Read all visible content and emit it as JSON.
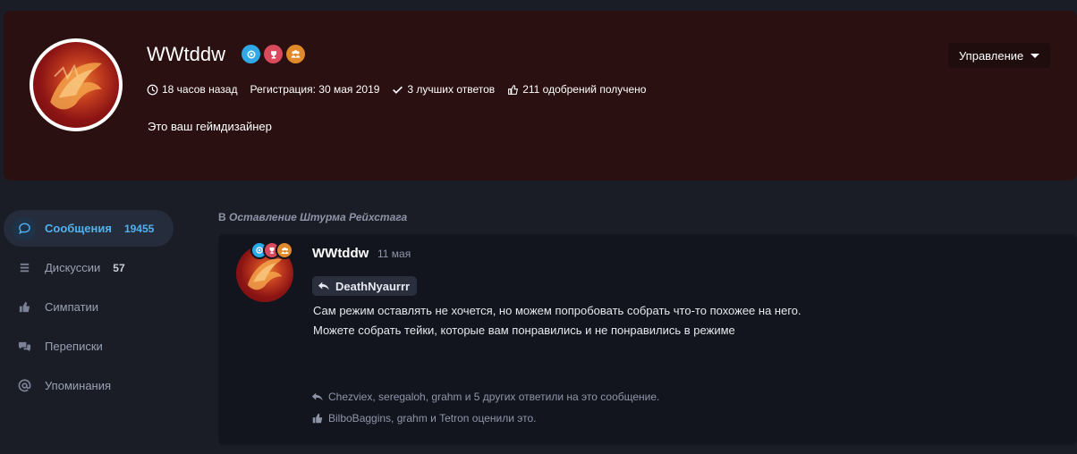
{
  "profile": {
    "username": "WWtddw",
    "last_seen": "18 часов назад",
    "registration": "Регистрация: 30 мая 2019",
    "best_answers": "3 лучших ответов",
    "reactions": "211 одобрений получено",
    "status_text": "Это ваш геймдизайнер",
    "manage_label": "Управление",
    "badges": [
      {
        "icon": "swirl-icon",
        "color": "#2fa8e6"
      },
      {
        "icon": "trophy-icon",
        "color": "#d84a5c"
      },
      {
        "icon": "group-icon",
        "color": "#e08a2a"
      }
    ]
  },
  "sidebar": {
    "items": [
      {
        "label": "Сообщения",
        "count": "19455",
        "icon": "message-icon",
        "active": true
      },
      {
        "label": "Дискуссии",
        "count": "57",
        "icon": "list-icon",
        "active": false
      },
      {
        "label": "Симпатии",
        "count": "",
        "icon": "thumbs-up-icon",
        "active": false
      },
      {
        "label": "Переписки",
        "count": "",
        "icon": "chat-icon",
        "active": false
      },
      {
        "label": "Упоминания",
        "count": "",
        "icon": "at-icon",
        "active": false
      }
    ]
  },
  "post": {
    "breadcrumb_prefix": "В",
    "breadcrumb_thread": "Оставление Штурма Рейхстага",
    "author": "WWtddw",
    "date": "11 мая",
    "quote_user": "DeathNyaurrr",
    "lines": [
      "Сам режим оставлять не хочется, но можем попробовать собрать что-то похожее на него.",
      "Можете собрать тейки, которые вам понравились и не понравились в режиме"
    ],
    "replies_text": "Chezviex, seregaloh, grahm и 5 других ответили на это сообщение.",
    "likes_text": "BilboBaggins, grahm и Tetron оценили это."
  },
  "colors": {
    "accent": "#4fb2f2",
    "banner": "#2a1010",
    "background": "#1b1d26",
    "card": "#13151e"
  }
}
